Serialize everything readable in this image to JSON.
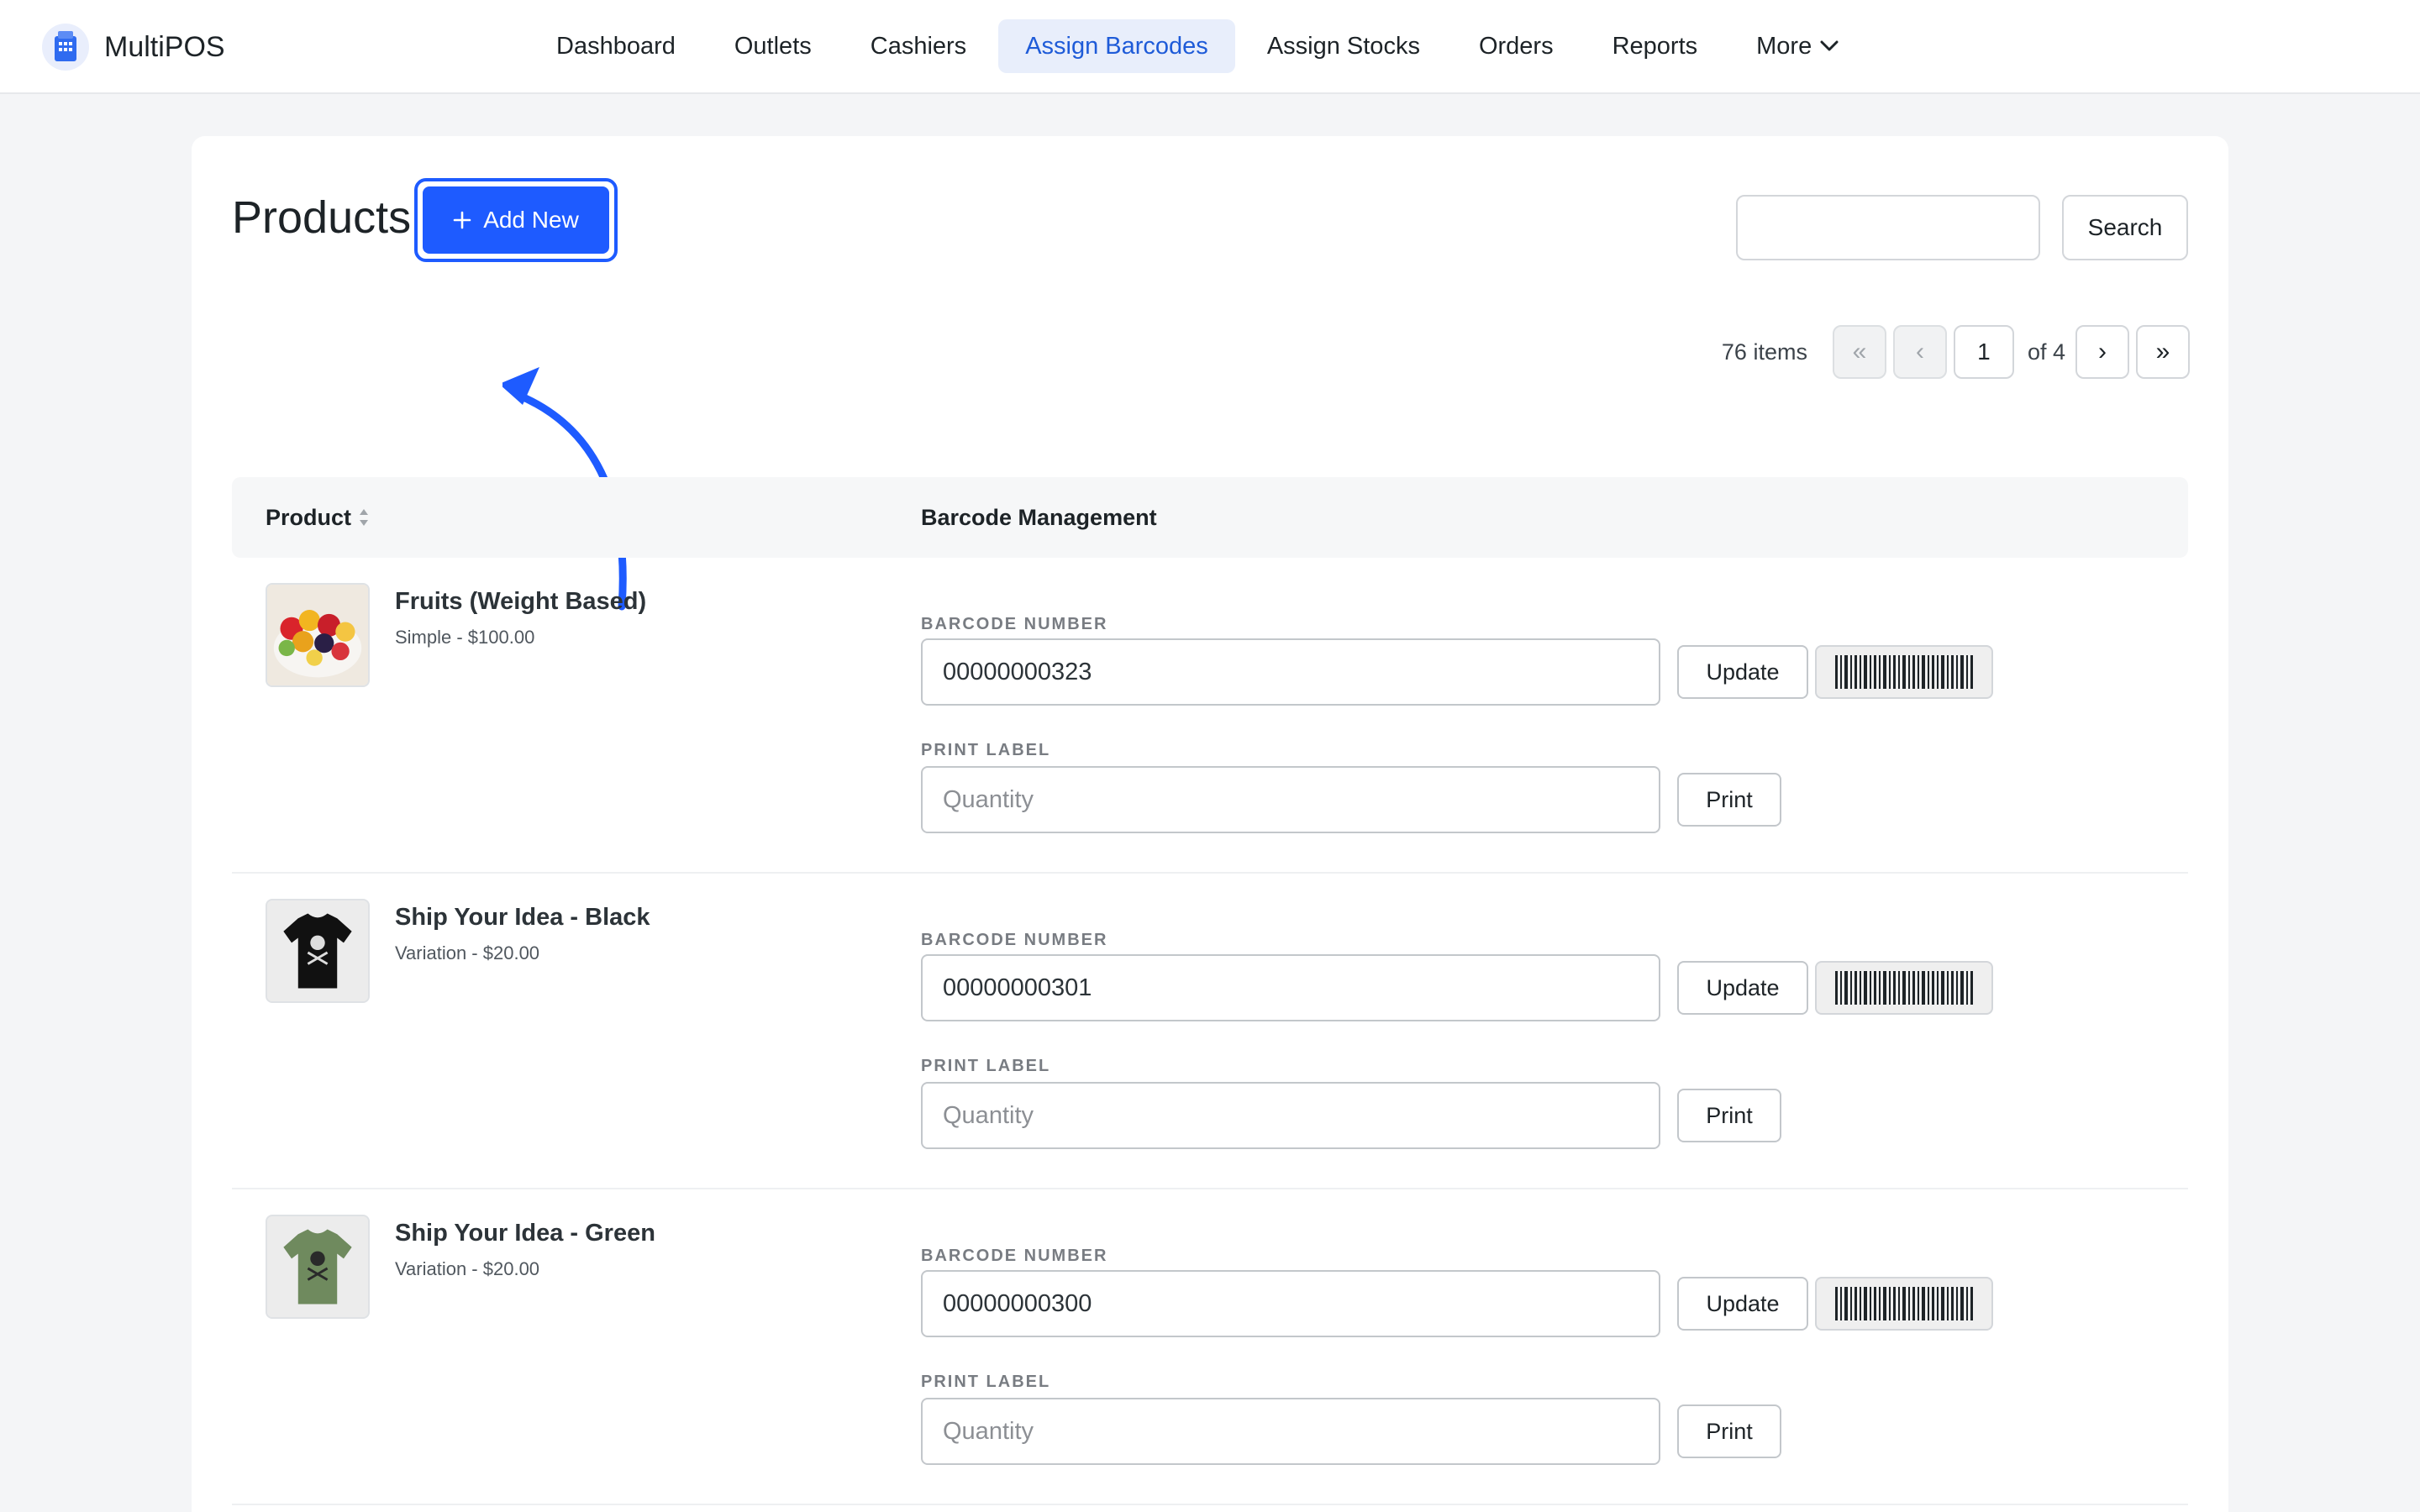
{
  "app": {
    "name": "MultiPOS"
  },
  "nav": {
    "items": [
      {
        "label": "Dashboard"
      },
      {
        "label": "Outlets"
      },
      {
        "label": "Cashiers"
      },
      {
        "label": "Assign Barcodes",
        "active": true
      },
      {
        "label": "Assign Stocks"
      },
      {
        "label": "Orders"
      },
      {
        "label": "Reports"
      },
      {
        "label": "More"
      }
    ]
  },
  "page": {
    "title": "Products",
    "add_new_label": "Add New",
    "search_value": "",
    "search_label": "Search"
  },
  "pagination": {
    "items_text": "76 items",
    "first": "«",
    "prev": "‹",
    "current_page": "1",
    "of_text": "of 4",
    "next": "›",
    "last": "»"
  },
  "table": {
    "col_product": "Product",
    "col_barcode": "Barcode Management",
    "barcode_label": "BARCODE NUMBER",
    "print_label": "PRINT LABEL",
    "quantity_placeholder": "Quantity",
    "update_label": "Update",
    "print_button": "Print",
    "rows": [
      {
        "name": "Fruits (Weight Based)",
        "meta": "Simple - $100.00",
        "barcode": "00000000323",
        "thumb": "fruit-bowl"
      },
      {
        "name": "Ship Your Idea - Black",
        "meta": "Variation - $20.00",
        "barcode": "00000000301",
        "thumb": "black-tshirt"
      },
      {
        "name": "Ship Your Idea - Green",
        "meta": "Variation - $20.00",
        "barcode": "00000000300",
        "thumb": "green-tshirt"
      }
    ]
  },
  "colors": {
    "accent": "#1e5bff",
    "nav_active_bg": "#e8eefb",
    "nav_active_text": "#1e5bd8"
  }
}
